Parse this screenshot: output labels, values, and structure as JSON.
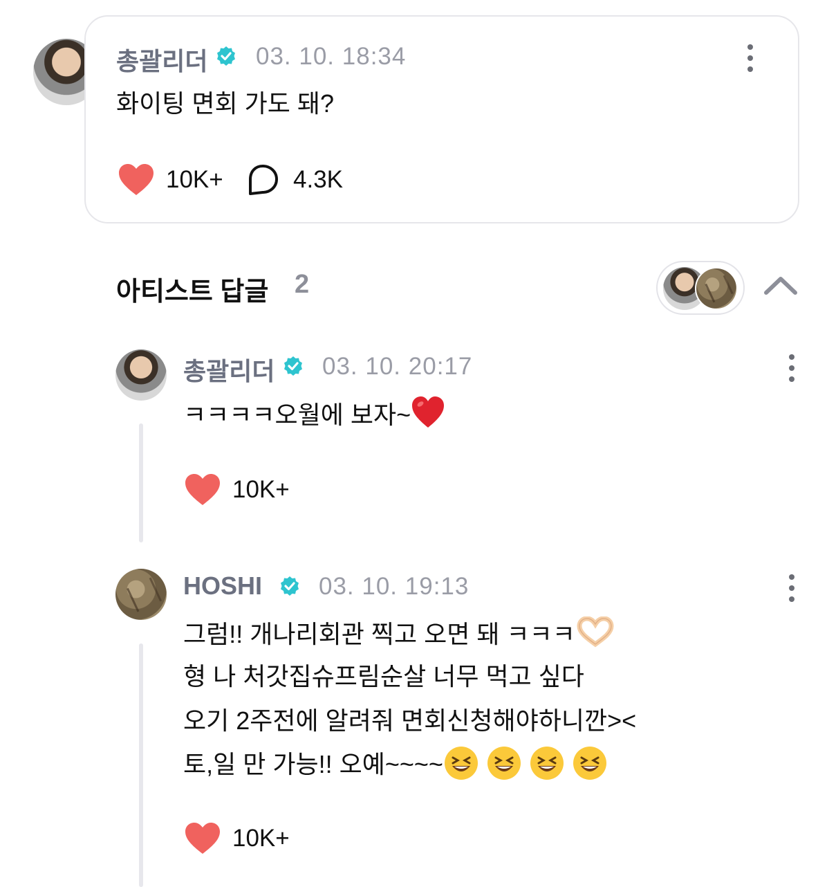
{
  "post": {
    "author": "총괄리더",
    "time": "03. 10. 18:34",
    "text": "화이팅 면회 가도 돼?",
    "likes": "10K+",
    "comments": "4.3K"
  },
  "replies_section": {
    "title": "아티스트 답글",
    "count": "2"
  },
  "replies": [
    {
      "author": "총괄리더",
      "time": "03. 10. 20:17",
      "text": "ㅋㅋㅋㅋ오월에 보자~",
      "likes": "10K+"
    },
    {
      "author": "HOSHI",
      "time": "03. 10. 19:13",
      "lines": [
        "그럼!! 개나리회관 찍고 오면 돼 ㅋㅋㅋ",
        "형 나 처갓집슈프림순살 너무 먹고 싶다",
        "오기 2주전에 알려줘 면회신청해야하니깐><",
        "토,일 만 가능!! 오예~~~~"
      ],
      "likes": "10K+"
    }
  ],
  "colors": {
    "heart": "#f0625e",
    "verified": "#2ec4cf",
    "name": "#6b7080",
    "time": "#9a9ca6"
  },
  "icons": [
    "verified-badge-icon",
    "kebab-menu-icon",
    "heart-icon",
    "comment-bubble-icon",
    "chevron-up-icon"
  ]
}
